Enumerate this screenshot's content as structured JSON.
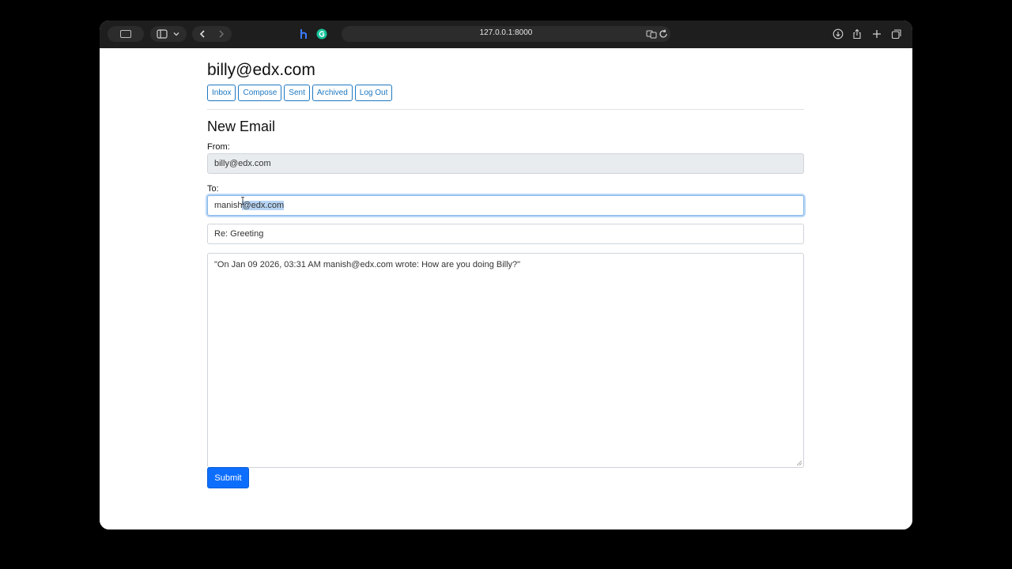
{
  "browser": {
    "url": "127.0.0.1:8000"
  },
  "header": {
    "user": "billy@edx.com",
    "nav": {
      "inbox": "Inbox",
      "compose": "Compose",
      "sent": "Sent",
      "archived": "Archived",
      "logout": "Log Out"
    }
  },
  "compose": {
    "title": "New Email",
    "from_label": "From:",
    "from_value": "billy@edx.com",
    "to_label": "To:",
    "to_value_unselected": "manish",
    "to_value_selected": "@edx.com",
    "subject_value": "Re: Greeting",
    "body_value": "\"On Jan 09 2026, 03:31 AM manish@edx.com wrote: How are you doing Billy?\"",
    "submit_label": "Submit"
  },
  "colors": {
    "accent": "#0d6efd",
    "nav_outline": "#1d78c1",
    "selection": "#b7d4f4"
  }
}
